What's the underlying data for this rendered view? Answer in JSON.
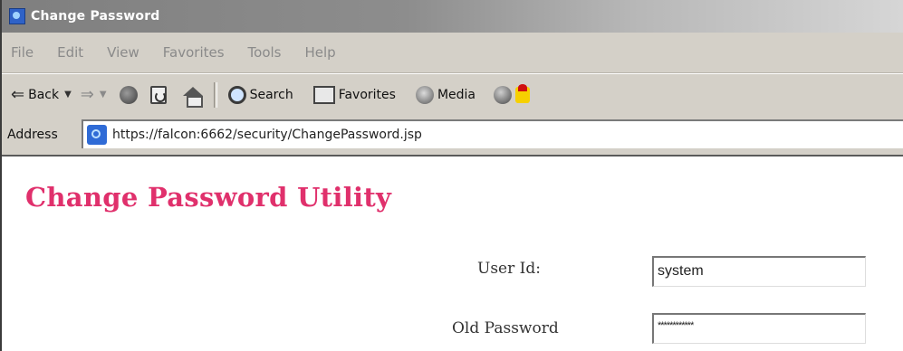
{
  "window": {
    "title": "Change Password"
  },
  "menu": [
    "File",
    "Edit",
    "View",
    "Favorites",
    "Tools",
    "Help"
  ],
  "toolbar": {
    "back": "Back",
    "search": "Search",
    "favorites": "Favorites",
    "media": "Media"
  },
  "address": {
    "label": "Address",
    "url": "https://falcon:6662/security/ChangePassword.jsp"
  },
  "page": {
    "title": "Change Password Utility",
    "user_id_label": "User Id:",
    "user_id_value": "system",
    "old_password_label": "Old Password",
    "old_password_value": "************"
  },
  "colors": {
    "title": "#e0306c",
    "chrome": "#d4d0c8"
  }
}
